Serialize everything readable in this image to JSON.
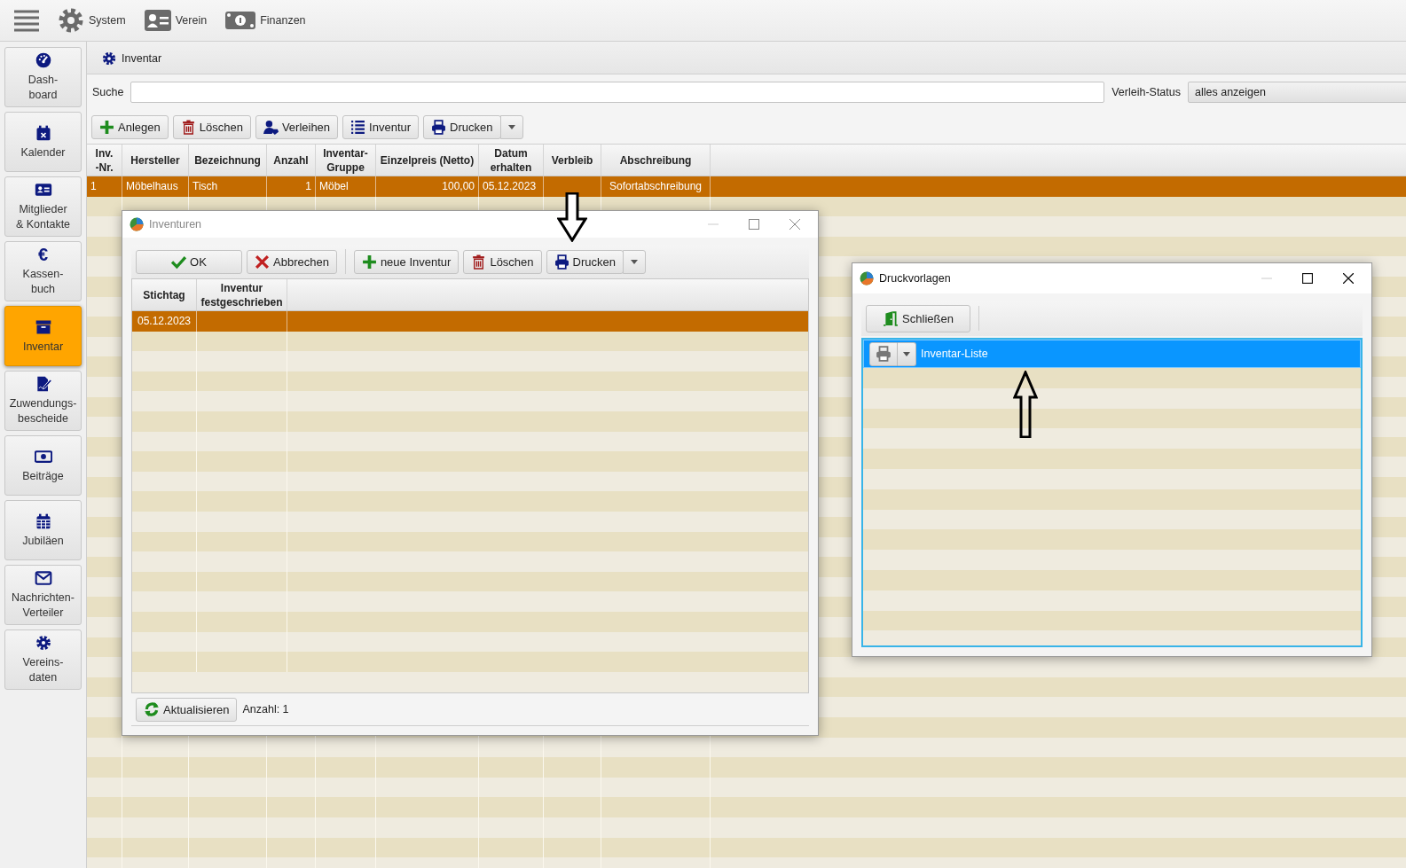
{
  "top_menu": [
    {
      "label": "System"
    },
    {
      "label": "Verein"
    },
    {
      "label": "Finanzen"
    }
  ],
  "sidebar": {
    "items": [
      {
        "label": "Dash-\nboard",
        "selected": false
      },
      {
        "label": "Kalender",
        "selected": false
      },
      {
        "label": "Mitglieder\n& Kontakte",
        "selected": false
      },
      {
        "label": "Kassen-\nbuch",
        "selected": false,
        "symbol": "€"
      },
      {
        "label": "Inventar",
        "selected": true
      },
      {
        "label": "Zuwendungs-\nbescheide",
        "selected": false
      },
      {
        "label": "Beiträge",
        "selected": false
      },
      {
        "label": "Jubiläen",
        "selected": false
      },
      {
        "label": "Nachrichten-\nVerteiler",
        "selected": false
      },
      {
        "label": "Vereins-\ndaten",
        "selected": false
      }
    ]
  },
  "tab": {
    "label": "Inventar"
  },
  "search": {
    "label": "Suche"
  },
  "status_filter": {
    "label": "Verleih-Status",
    "value": "alles anzeigen"
  },
  "toolbar": [
    {
      "label": "Anlegen"
    },
    {
      "label": "Löschen"
    },
    {
      "label": "Verleihen"
    },
    {
      "label": "Inventur"
    },
    {
      "label": "Drucken",
      "kind": "split"
    }
  ],
  "table": {
    "columns": [
      "Inv.\n-Nr.",
      "Hersteller",
      "Bezeichnung",
      "Anzahl",
      "Inventar-\nGruppe",
      "Einzelpreis (Netto)",
      "Datum\nerhalten",
      "Verbleib",
      "Abschreibung"
    ],
    "rows": [
      {
        "selected": true,
        "cells": [
          "1",
          "Möbelhaus",
          "Tisch",
          "1",
          "Möbel",
          "100,00",
          "05.12.2023",
          "",
          "Sofortabschreibung"
        ]
      }
    ]
  },
  "inventuren_dialog": {
    "title": "Inventuren",
    "toolbar": [
      {
        "label": "OK"
      },
      {
        "label": "Abbrechen"
      },
      {
        "label": "neue Inventur"
      },
      {
        "label": "Löschen"
      },
      {
        "label": "Drucken",
        "kind": "split"
      }
    ],
    "columns": [
      "Stichtag",
      "Inventur\nfestgeschrieben"
    ],
    "rows": [
      {
        "selected": true,
        "cells": [
          "05.12.2023",
          ""
        ]
      }
    ],
    "refresh_button": "Aktualisieren",
    "count": "Anzahl: 1"
  },
  "druckvorlagen_dialog": {
    "title": "Druckvorlagen",
    "close_button": "Schließen",
    "items": [
      {
        "label": "Inventar-Liste",
        "selected": true
      }
    ]
  }
}
